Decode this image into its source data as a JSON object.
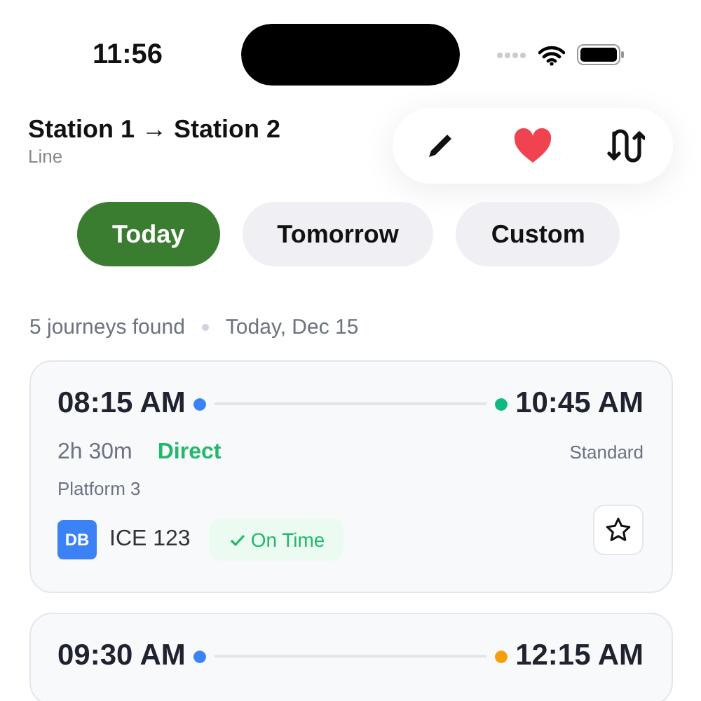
{
  "status_bar": {
    "time": "11:56"
  },
  "header": {
    "title": "Station 1 → Station 2",
    "subtitle": "Line",
    "actions": [
      {
        "kind": "edit"
      },
      {
        "kind": "favorite",
        "on": true
      },
      {
        "kind": "swap"
      }
    ]
  },
  "day_tabs": [
    {
      "label": "Today",
      "selected": true
    },
    {
      "label": "Tomorrow",
      "selected": false
    },
    {
      "label": "Custom",
      "selected": false
    }
  ],
  "summary": {
    "count": "5 journeys found",
    "date": "Today, Dec 15"
  },
  "journeys": [
    {
      "stops": [
        {
          "time": "08:15 AM",
          "color": "#3b82f6"
        },
        {
          "time": "10:45 AM",
          "color": "#10b981"
        }
      ],
      "duration": "2h 30m",
      "type": "Direct",
      "fare": "Standard",
      "platform": "Platform 3",
      "operator": "DB",
      "train": "ICE 123",
      "status": "On Time",
      "starred": false
    },
    {
      "stops": [
        {
          "time": "09:30 AM",
          "color": "#3b82f6"
        },
        {
          "time": "12:15 AM",
          "color": "#f59e0b"
        }
      ]
    }
  ]
}
